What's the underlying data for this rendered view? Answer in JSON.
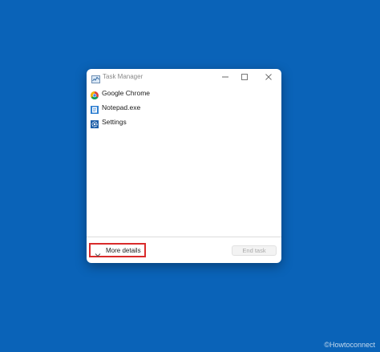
{
  "window": {
    "title": "Task Manager",
    "title_icon": "task-manager-icon",
    "controls": {
      "minimize_icon": "minimize-icon",
      "maximize_icon": "maximize-icon",
      "close_icon": "close-icon"
    }
  },
  "processes": [
    {
      "name": "Google Chrome",
      "icon": "chrome-icon"
    },
    {
      "name": "Notepad.exe",
      "icon": "notepad-icon"
    },
    {
      "name": "Settings",
      "icon": "settings-icon"
    }
  ],
  "footer": {
    "more_details_label": "More details",
    "more_details_icon": "chevron-down-icon",
    "end_task_label": "End task"
  },
  "watermark": "©Howtoconnect",
  "colors": {
    "desktop": "#0a63b8",
    "highlight_border": "#d92b2b"
  }
}
